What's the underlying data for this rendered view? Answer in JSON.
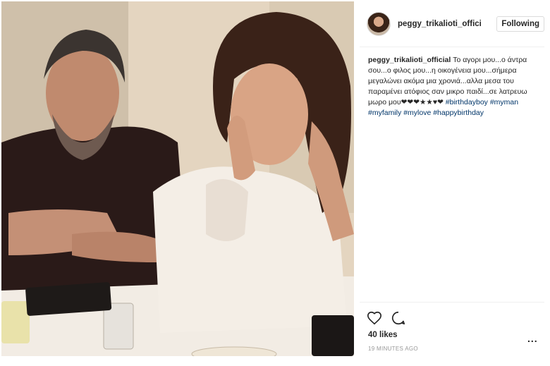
{
  "header": {
    "username": "peggy_trikalioti_offici",
    "follow_label": "Following"
  },
  "caption": {
    "username": "peggy_trikalioti_official",
    "text": "Το αγορι μου...ο άντρα σου...ο φιλος μου...η οικογένεια μου...σήμερα μεγαλώνει ακόμα μια χρονιά...αλλα μεσα του παραμένει ατόφιος σαν μικρο παιδί...σε λατρευω μωρο μου",
    "emoji": "❤❤❤★★♥❤",
    "hashtags": [
      "#birthdayboy",
      "#myman",
      "#myfamily",
      "#mylove",
      "#happybirthday"
    ]
  },
  "stats": {
    "likes": "40 likes",
    "time": "19 MINUTES AGO",
    "more": "..."
  },
  "icons": {
    "like": "heart-icon",
    "comment": "comment-icon",
    "more": "more-options-icon"
  },
  "colors": {
    "hashtag": "#003569",
    "text": "#262626",
    "muted": "#999999",
    "border": "#dbdbdb"
  }
}
